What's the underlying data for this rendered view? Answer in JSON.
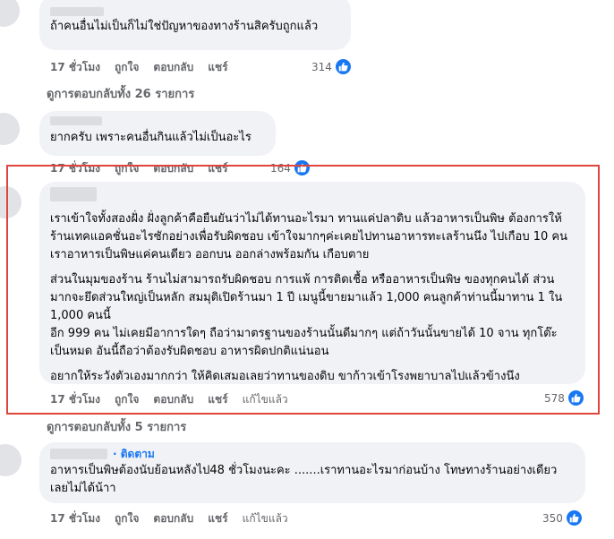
{
  "comments": [
    {
      "text": "ถ้าคนอื่นไม่เป็นก็ไม่ใช่ปัญหาของทางร้านสิครับถูกแล้ว",
      "time": "17 ชั่วโมง",
      "like": "ถูกใจ",
      "reply": "ตอบกลับ",
      "share": "แชร์",
      "reactions": "314"
    },
    {
      "text": "ยากครับ เพราะคนอื่นกินแล้วไม่เป็นอะไร",
      "time": "17 ชั่วโมง",
      "like": "ถูกใจ",
      "reply": "ตอบกลับ",
      "share": "แชร์",
      "reactions": "164"
    },
    {
      "paragraphs": [
        "เราเข้าใจทั้งสองฝั่ง ฝั่งลูกค้าคือยืนยันว่าไม่ได้ทานอะไรมา ทานแค่ปลาดิบ แล้วอาหารเป็นพิษ ต้องการให้ร้านเทคแอคชั่นอะไรซักอย่างเพื่อรับผิดชอบ เข้าใจมากๆค่ะเคยไปทานอาหารทะเลร้านนึง ไปเกือบ 10 คน เราอาหารเป็นพิษแค่คนเดียว ออกบน ออกล่างพร้อมกัน เกือบตาย",
        "ส่วนในมุมของร้าน ร้านไม่สามารถรับผิดชอบ การแพ้ การติดเชื้อ หรืออาหารเป็นพิษ ของทุกคนได้ ส่วนมากจะยึดส่วนใหญ่เป็นหลัก สมมุติเปิดร้านมา 1 ปี เมนูนี้ขายมาแล้ว 1,000 คนลูกค้าท่านนี้มาทาน 1 ใน 1,000 คนนี้\nอีก 999 คน ไม่เคยมีอาการใดๆ ถือว่ามาตรฐานของร้านนั้นดีมากๆ แต่ถ้าวันนั้นขายได้ 10 จาน ทุกโต๊ะเป็นหมด อันนี้ถือว่าต้องรับผิดชอบ อาหารผิดปกติแน่นอน",
        "อยากให้ระวังตัวเองมากกว่า ให้คิดเสมอเลยว่าทานของดิบ ขาก้าวเข้าโรงพยาบาลไปแล้วข้างนึง"
      ],
      "time": "17 ชั่วโมง",
      "like": "ถูกใจ",
      "reply": "ตอบกลับ",
      "share": "แชร์",
      "edited": "แก้ไขแล้ว",
      "reactions": "578"
    },
    {
      "follow": "· ติดตาม",
      "text": "อาหารเป็นพิษต้องนับย้อนหลังไป48 ชั่วโมงนะคะ .......เราทานอะไรมาก่อนบ้าง โทษทางร้านอย่างเดียวเลยไม่ได้น้าา",
      "time": "17 ชั่วโมง",
      "like": "ถูกใจ",
      "reply": "ตอบกลับ",
      "share": "แชร์",
      "edited": "แก้ไขแล้ว",
      "reactions": "350"
    }
  ],
  "view_replies": [
    "ดูการตอบกลับทั้ง 26 รายการ",
    "ดูการตอบกลับทั้ง 5 รายการ"
  ],
  "colors": {
    "bubble": "#f0f2f5",
    "meta_text": "#65676b",
    "like_blue": "#1877f2",
    "highlight_red": "#e0443d"
  }
}
